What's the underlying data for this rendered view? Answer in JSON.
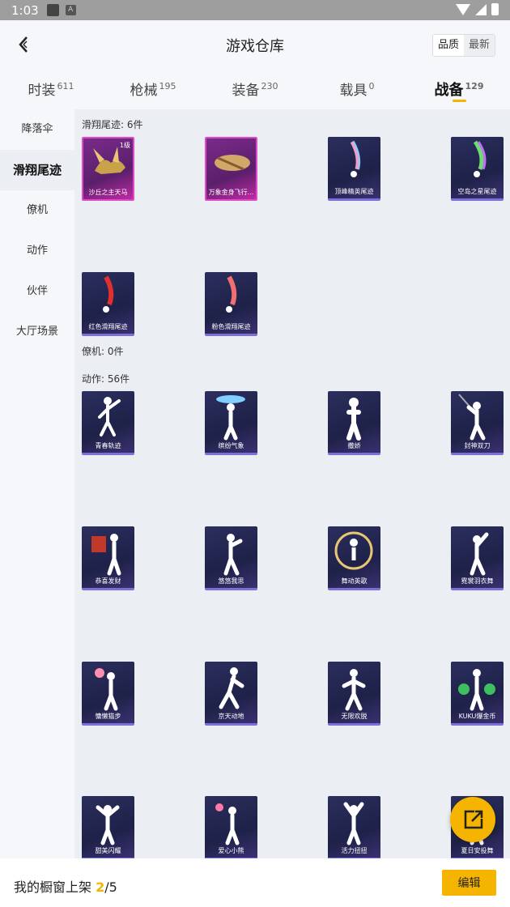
{
  "status_bar": {
    "time": "1:03",
    "app_icon_letter": "A"
  },
  "header": {
    "title": "游戏仓库",
    "back_icon": "back-arrow-icon",
    "sort_options": [
      "品质",
      "最新"
    ],
    "sort_selected": "品质"
  },
  "tabs": [
    {
      "label": "时装",
      "count": "611"
    },
    {
      "label": "枪械",
      "count": "195"
    },
    {
      "label": "装备",
      "count": "230"
    },
    {
      "label": "载具",
      "count": "0"
    },
    {
      "label": "战备",
      "count": "129"
    }
  ],
  "sidebar": {
    "items": [
      {
        "label": "降落伞"
      },
      {
        "label": "滑翔尾迹"
      },
      {
        "label": "僚机"
      },
      {
        "label": "动作"
      },
      {
        "label": "伙伴"
      },
      {
        "label": "大厅场景"
      }
    ]
  },
  "sections": {
    "trail": {
      "title": "滑翔尾迹: 6件",
      "items": [
        "沙丘之主天马",
        "万象金身飞行...",
        "顶峰精英尾迹",
        "空岛之星尾迹",
        "红色滑翔尾迹",
        "粉色滑翔尾迹"
      ],
      "level_badge": "1级"
    },
    "wingman": {
      "title": "僚机: 0件"
    },
    "emote": {
      "title": "动作: 56件",
      "items": [
        "青春轨迹",
        "缤纷气象",
        "撒娇",
        "封神双刀",
        "恭喜发财",
        "悠悠我思",
        "舞动英歌",
        "霓裳羽衣舞",
        "慵懒猫步",
        "京天动地",
        "无限欢脱",
        "KUKU爆金币",
        "甜美闪耀",
        "爱心小熊",
        "活力扭扭",
        "夏日安投舞"
      ]
    }
  },
  "bottom_bar": {
    "label": "我的橱窗上架 ",
    "shown": "2",
    "separator": "/",
    "total": "5",
    "edit_label": "编辑"
  },
  "fab_icon": "share-external-icon",
  "colors": {
    "accent": "#f5b400",
    "card_bg": "#1e2148",
    "card_pink": "#e04ac8"
  }
}
